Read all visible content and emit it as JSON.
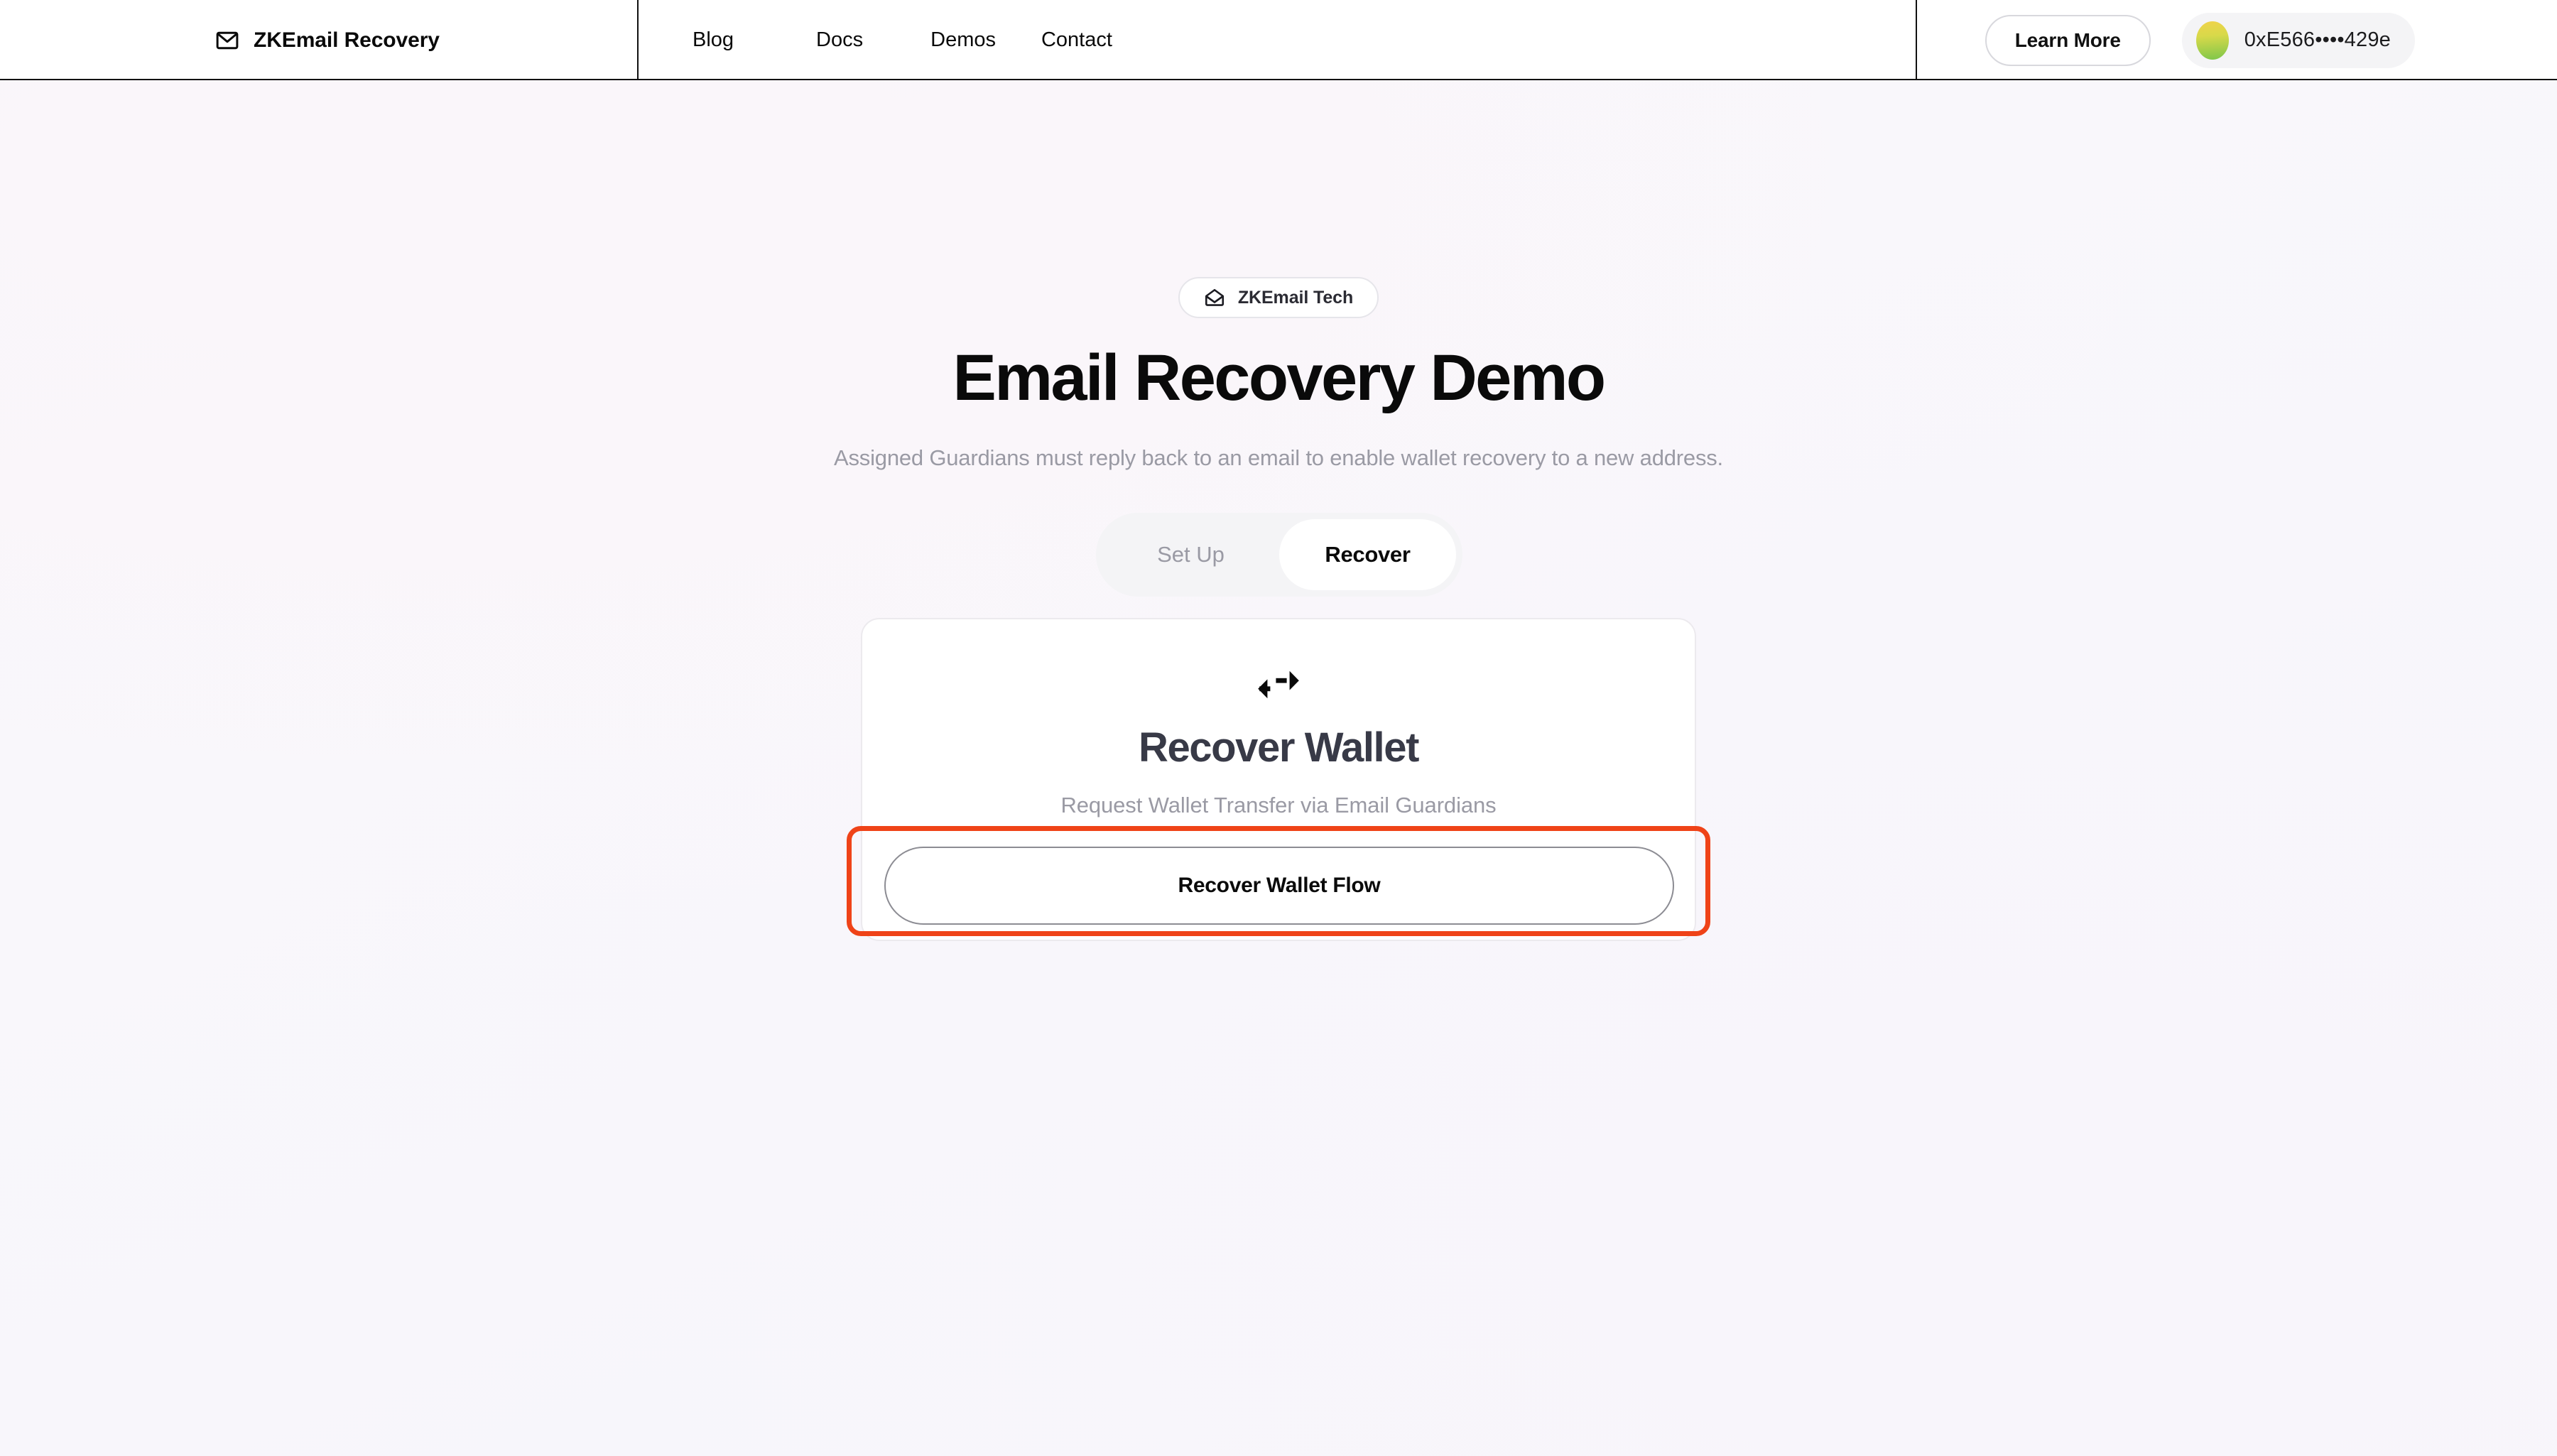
{
  "header": {
    "brand": {
      "icon": "envelope-icon",
      "label": "ZKEmail Recovery"
    },
    "nav_items": [
      {
        "label": "Blog"
      },
      {
        "label": "Docs"
      },
      {
        "label": "Demos"
      },
      {
        "label": "Contact"
      }
    ],
    "learn_more_label": "Learn More",
    "wallet": {
      "avatar_icon": "wallet-avatar-gradient",
      "address": "0xE566••••429e",
      "avatar_colors": [
        "#f0d34a",
        "#7cc64a"
      ]
    }
  },
  "hero": {
    "badge": {
      "icon": "open-envelope-icon",
      "label": "ZKEmail Tech"
    },
    "title": "Email Recovery Demo",
    "subtitle": "Assigned Guardians must reply back to an email to enable wallet recovery to a new address."
  },
  "toggle": {
    "options": [
      {
        "label": "Set Up",
        "active": false
      },
      {
        "label": "Recover",
        "active": true
      }
    ]
  },
  "card": {
    "icon": "swap-arrows-icon",
    "title": "Recover Wallet",
    "description": "Request Wallet Transfer via Email Guardians",
    "cta_label": "Recover Wallet Flow"
  },
  "annotation": {
    "name": "highlight-box",
    "color": "#ef4318",
    "target": "Recover Wallet Flow"
  },
  "colors": {
    "page_background": "#f8f7fc",
    "header_background": "#ffffff",
    "header_border": "#111111",
    "text_primary": "#0a0a0a",
    "text_muted": "#9a9aa4",
    "card_title": "#383a47",
    "toggle_track": "#f4f4f6",
    "highlight": "#ef4318"
  }
}
